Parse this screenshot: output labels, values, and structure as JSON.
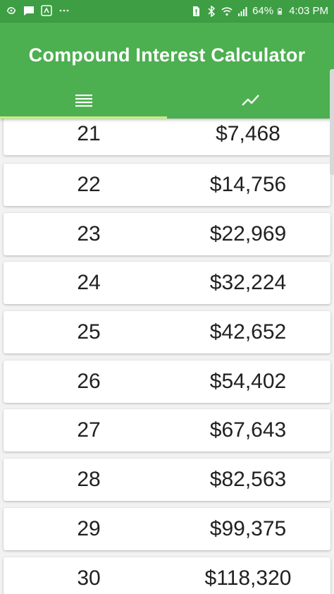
{
  "status_bar": {
    "battery_percent": "64%",
    "time": "4:03 PM",
    "left_icons": [
      "sync-icon",
      "message-icon",
      "pay-icon",
      "more-dots-icon"
    ],
    "right_icons": [
      "sim-alert-icon",
      "bluetooth-icon",
      "wifi-icon",
      "signal-icon",
      "battery-icon"
    ]
  },
  "app_bar": {
    "title": "Compound Interest Calculator",
    "background_color": "#4caf50",
    "tabs": [
      {
        "icon": "list-icon",
        "active": true
      },
      {
        "icon": "trending-up-icon",
        "active": false
      }
    ],
    "indicator_color": "#c6f07a"
  },
  "rows": [
    {
      "year": "21",
      "amount": "$7,468"
    },
    {
      "year": "22",
      "amount": "$14,756"
    },
    {
      "year": "23",
      "amount": "$22,969"
    },
    {
      "year": "24",
      "amount": "$32,224"
    },
    {
      "year": "25",
      "amount": "$42,652"
    },
    {
      "year": "26",
      "amount": "$54,402"
    },
    {
      "year": "27",
      "amount": "$67,643"
    },
    {
      "year": "28",
      "amount": "$82,563"
    },
    {
      "year": "29",
      "amount": "$99,375"
    },
    {
      "year": "30",
      "amount": "$118,320"
    }
  ]
}
